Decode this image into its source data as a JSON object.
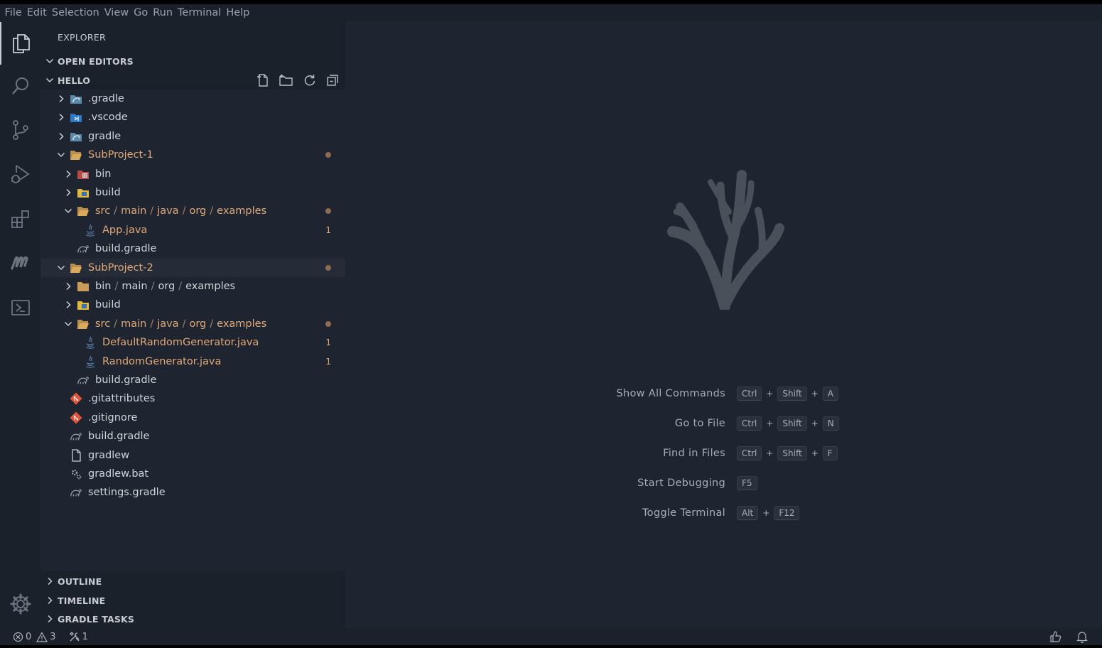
{
  "menu": [
    "File",
    "Edit",
    "Selection",
    "View",
    "Go",
    "Run",
    "Terminal",
    "Help"
  ],
  "sidebar": {
    "title": "EXPLORER",
    "open_editors": "OPEN EDITORS",
    "workspace": "HELLO",
    "outline": "OUTLINE",
    "timeline": "TIMELINE",
    "gradle_tasks": "GRADLE TASKS"
  },
  "tree": [
    {
      "label": ".gradle",
      "icon": "gradle-folder-icon",
      "chevron": "right",
      "depth": 0
    },
    {
      "label": ".vscode",
      "icon": "vscode-folder-icon",
      "chevron": "right",
      "depth": 0
    },
    {
      "label": "gradle",
      "icon": "gradle-folder-icon",
      "chevron": "right",
      "depth": 0
    },
    {
      "label": "SubProject-1",
      "icon": "folder-open-icon",
      "chevron": "down",
      "depth": 0,
      "modified": true,
      "dot": true
    },
    {
      "label": "bin",
      "icon": "bin-folder-icon",
      "chevron": "right",
      "depth": 1
    },
    {
      "label": "build",
      "icon": "build-folder-icon",
      "chevron": "right",
      "depth": 1
    },
    {
      "parts": [
        "src",
        "main",
        "java",
        "org",
        "examples"
      ],
      "icon": "folder-open-icon",
      "chevron": "down",
      "depth": 1,
      "modified": true,
      "dot": true
    },
    {
      "label": "App.java",
      "icon": "java-file-icon",
      "chevron": "none",
      "depth": 2,
      "modified": true,
      "badge": "1"
    },
    {
      "label": "build.gradle",
      "icon": "gradle-file-icon",
      "chevron": "none",
      "depth": 1
    },
    {
      "label": "SubProject-2",
      "icon": "folder-open-icon",
      "chevron": "down",
      "depth": 0,
      "modified": true,
      "dot": true,
      "selected": true
    },
    {
      "parts": [
        "bin",
        "main",
        "org",
        "examples"
      ],
      "icon": "folder-icon",
      "chevron": "right",
      "depth": 1
    },
    {
      "label": "build",
      "icon": "build-folder-icon",
      "chevron": "right",
      "depth": 1
    },
    {
      "parts": [
        "src",
        "main",
        "java",
        "org",
        "examples"
      ],
      "icon": "folder-open-icon",
      "chevron": "down",
      "depth": 1,
      "modified": true,
      "dot": true
    },
    {
      "label": "DefaultRandomGenerator.java",
      "icon": "java-file-icon",
      "chevron": "none",
      "depth": 2,
      "modified": true,
      "badge": "1"
    },
    {
      "label": "RandomGenerator.java",
      "icon": "java-file-icon",
      "chevron": "none",
      "depth": 2,
      "modified": true,
      "badge": "1"
    },
    {
      "label": "build.gradle",
      "icon": "gradle-file-icon",
      "chevron": "none",
      "depth": 1
    },
    {
      "label": ".gitattributes",
      "icon": "git-icon",
      "chevron": "none",
      "depth": 0
    },
    {
      "label": ".gitignore",
      "icon": "git-icon",
      "chevron": "none",
      "depth": 0
    },
    {
      "label": "build.gradle",
      "icon": "gradle-file-icon",
      "chevron": "none",
      "depth": 0
    },
    {
      "label": "gradlew",
      "icon": "file-icon",
      "chevron": "none",
      "depth": 0
    },
    {
      "label": "gradlew.bat",
      "icon": "gear-file-icon",
      "chevron": "none",
      "depth": 0
    },
    {
      "label": "settings.gradle",
      "icon": "gradle-file-icon",
      "chevron": "none",
      "depth": 0
    }
  ],
  "shortcuts": [
    {
      "name": "Show All Commands",
      "keys": [
        "Ctrl",
        "Shift",
        "A"
      ]
    },
    {
      "name": "Go to File",
      "keys": [
        "Ctrl",
        "Shift",
        "N"
      ]
    },
    {
      "name": "Find in Files",
      "keys": [
        "Ctrl",
        "Shift",
        "F"
      ]
    },
    {
      "name": "Start Debugging",
      "keys": [
        "F5"
      ]
    },
    {
      "name": "Toggle Terminal",
      "keys": [
        "Alt",
        "F12"
      ]
    }
  ],
  "status": {
    "errors": "0",
    "warnings": "3",
    "ports": "1"
  },
  "colors": {
    "modified": "#e0a977",
    "sidebar_bg": "#1b212b",
    "editor_bg": "#1e2430"
  }
}
